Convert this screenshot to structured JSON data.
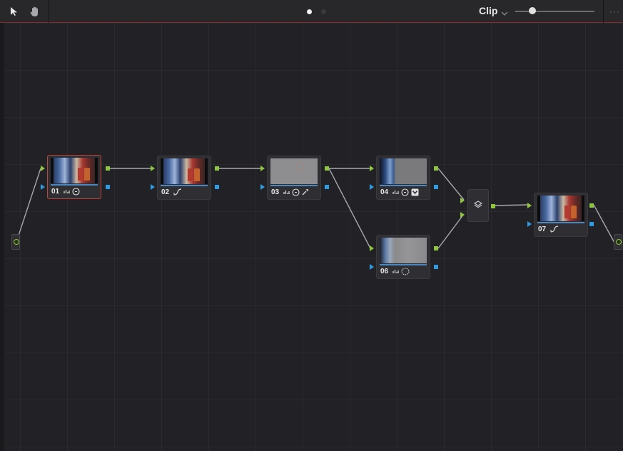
{
  "toolbar": {
    "pointer_icon": "pointer-icon",
    "hand_icon": "hand-icon",
    "clip_label": "Clip",
    "more_label": "···",
    "zoom_slider_value": 0.22
  },
  "node_graph": {
    "nodes": [
      {
        "number": "01",
        "tools": [
          "scopes-icon",
          "circle-window-icon"
        ],
        "selected": true
      },
      {
        "number": "02",
        "tools": [
          "curve-icon"
        ],
        "selected": false
      },
      {
        "number": "03",
        "tools": [
          "scopes-icon",
          "circle-window-icon",
          "picker-icon"
        ],
        "selected": false
      },
      {
        "number": "04",
        "tools": [
          "scopes-icon",
          "circle-window-icon",
          "key-icon"
        ],
        "selected": false
      },
      {
        "number": "06",
        "tools": [
          "scopes-icon",
          "dotted-circle-icon"
        ],
        "selected": false
      },
      {
        "number": "07",
        "tools": [
          "curve-icon"
        ],
        "selected": false
      }
    ],
    "mixer_icon": "layer-mixer-icon"
  },
  "colors": {
    "accent_green": "#8ec63f",
    "accent_blue": "#2f9be0",
    "selected_border": "#c0453a",
    "background": "#222226"
  }
}
